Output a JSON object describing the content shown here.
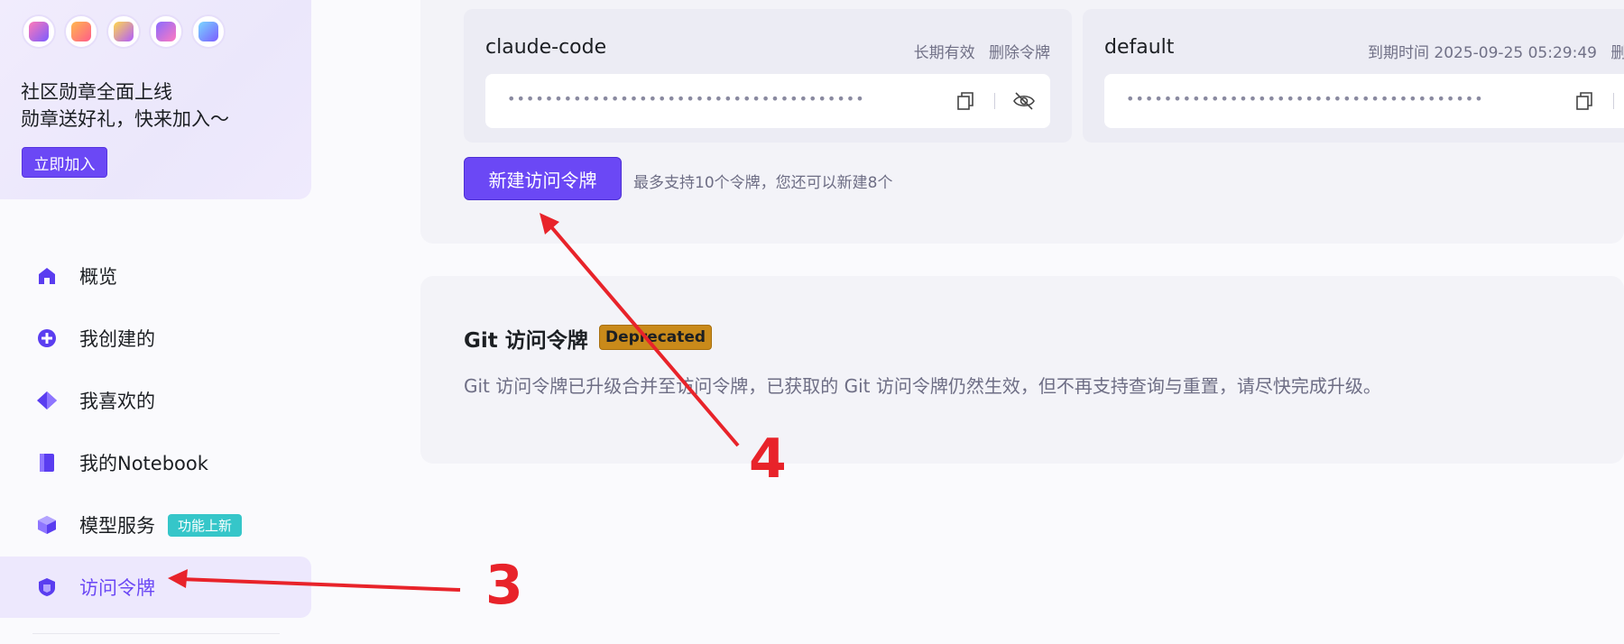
{
  "promo": {
    "line1": "社区勋章全面上线",
    "line2": "勋章送好礼，快来加入～",
    "join_label": "立即加入",
    "badges": [
      "badge-1",
      "badge-2",
      "badge-3",
      "badge-4",
      "badge-5"
    ]
  },
  "sidebar": {
    "items": [
      {
        "label": "概览",
        "icon": "home-icon"
      },
      {
        "label": "我创建的",
        "icon": "plus-circle-icon"
      },
      {
        "label": "我喜欢的",
        "icon": "diamond-icon"
      },
      {
        "label": "我的Notebook",
        "icon": "notebook-icon"
      },
      {
        "label": "模型服务",
        "icon": "cube-icon",
        "tag": "功能上新"
      },
      {
        "label": "访问令牌",
        "icon": "shield-icon",
        "active": true
      }
    ]
  },
  "tokens": [
    {
      "name": "claude-code",
      "validity": "长期有效",
      "delete_label": "删除令牌",
      "masked": "••••••••••••••••••••••••••••••••••••••"
    },
    {
      "name": "default",
      "validity": "到期时间 2025-09-25 05:29:49",
      "delete_label": "删除令牌",
      "masked": "••••••••••••••••••••••••••••••••••••••"
    }
  ],
  "new_token": {
    "button_label": "新建访问令牌",
    "limit_text": "最多支持10个令牌，您还可以新建8个"
  },
  "git": {
    "title": "Git 访问令牌",
    "badge": "Deprecated",
    "description": "Git 访问令牌已升级合并至访问令牌，已获取的 Git 访问令牌仍然生效，但不再支持查询与重置，请尽快完成升级。"
  },
  "annotations": {
    "step3": "3",
    "step4": "4",
    "color": "#e8232a"
  },
  "colors": {
    "accent": "#6b48f5",
    "tag": "#35c6c9",
    "deprecated": "#c98a1a"
  }
}
